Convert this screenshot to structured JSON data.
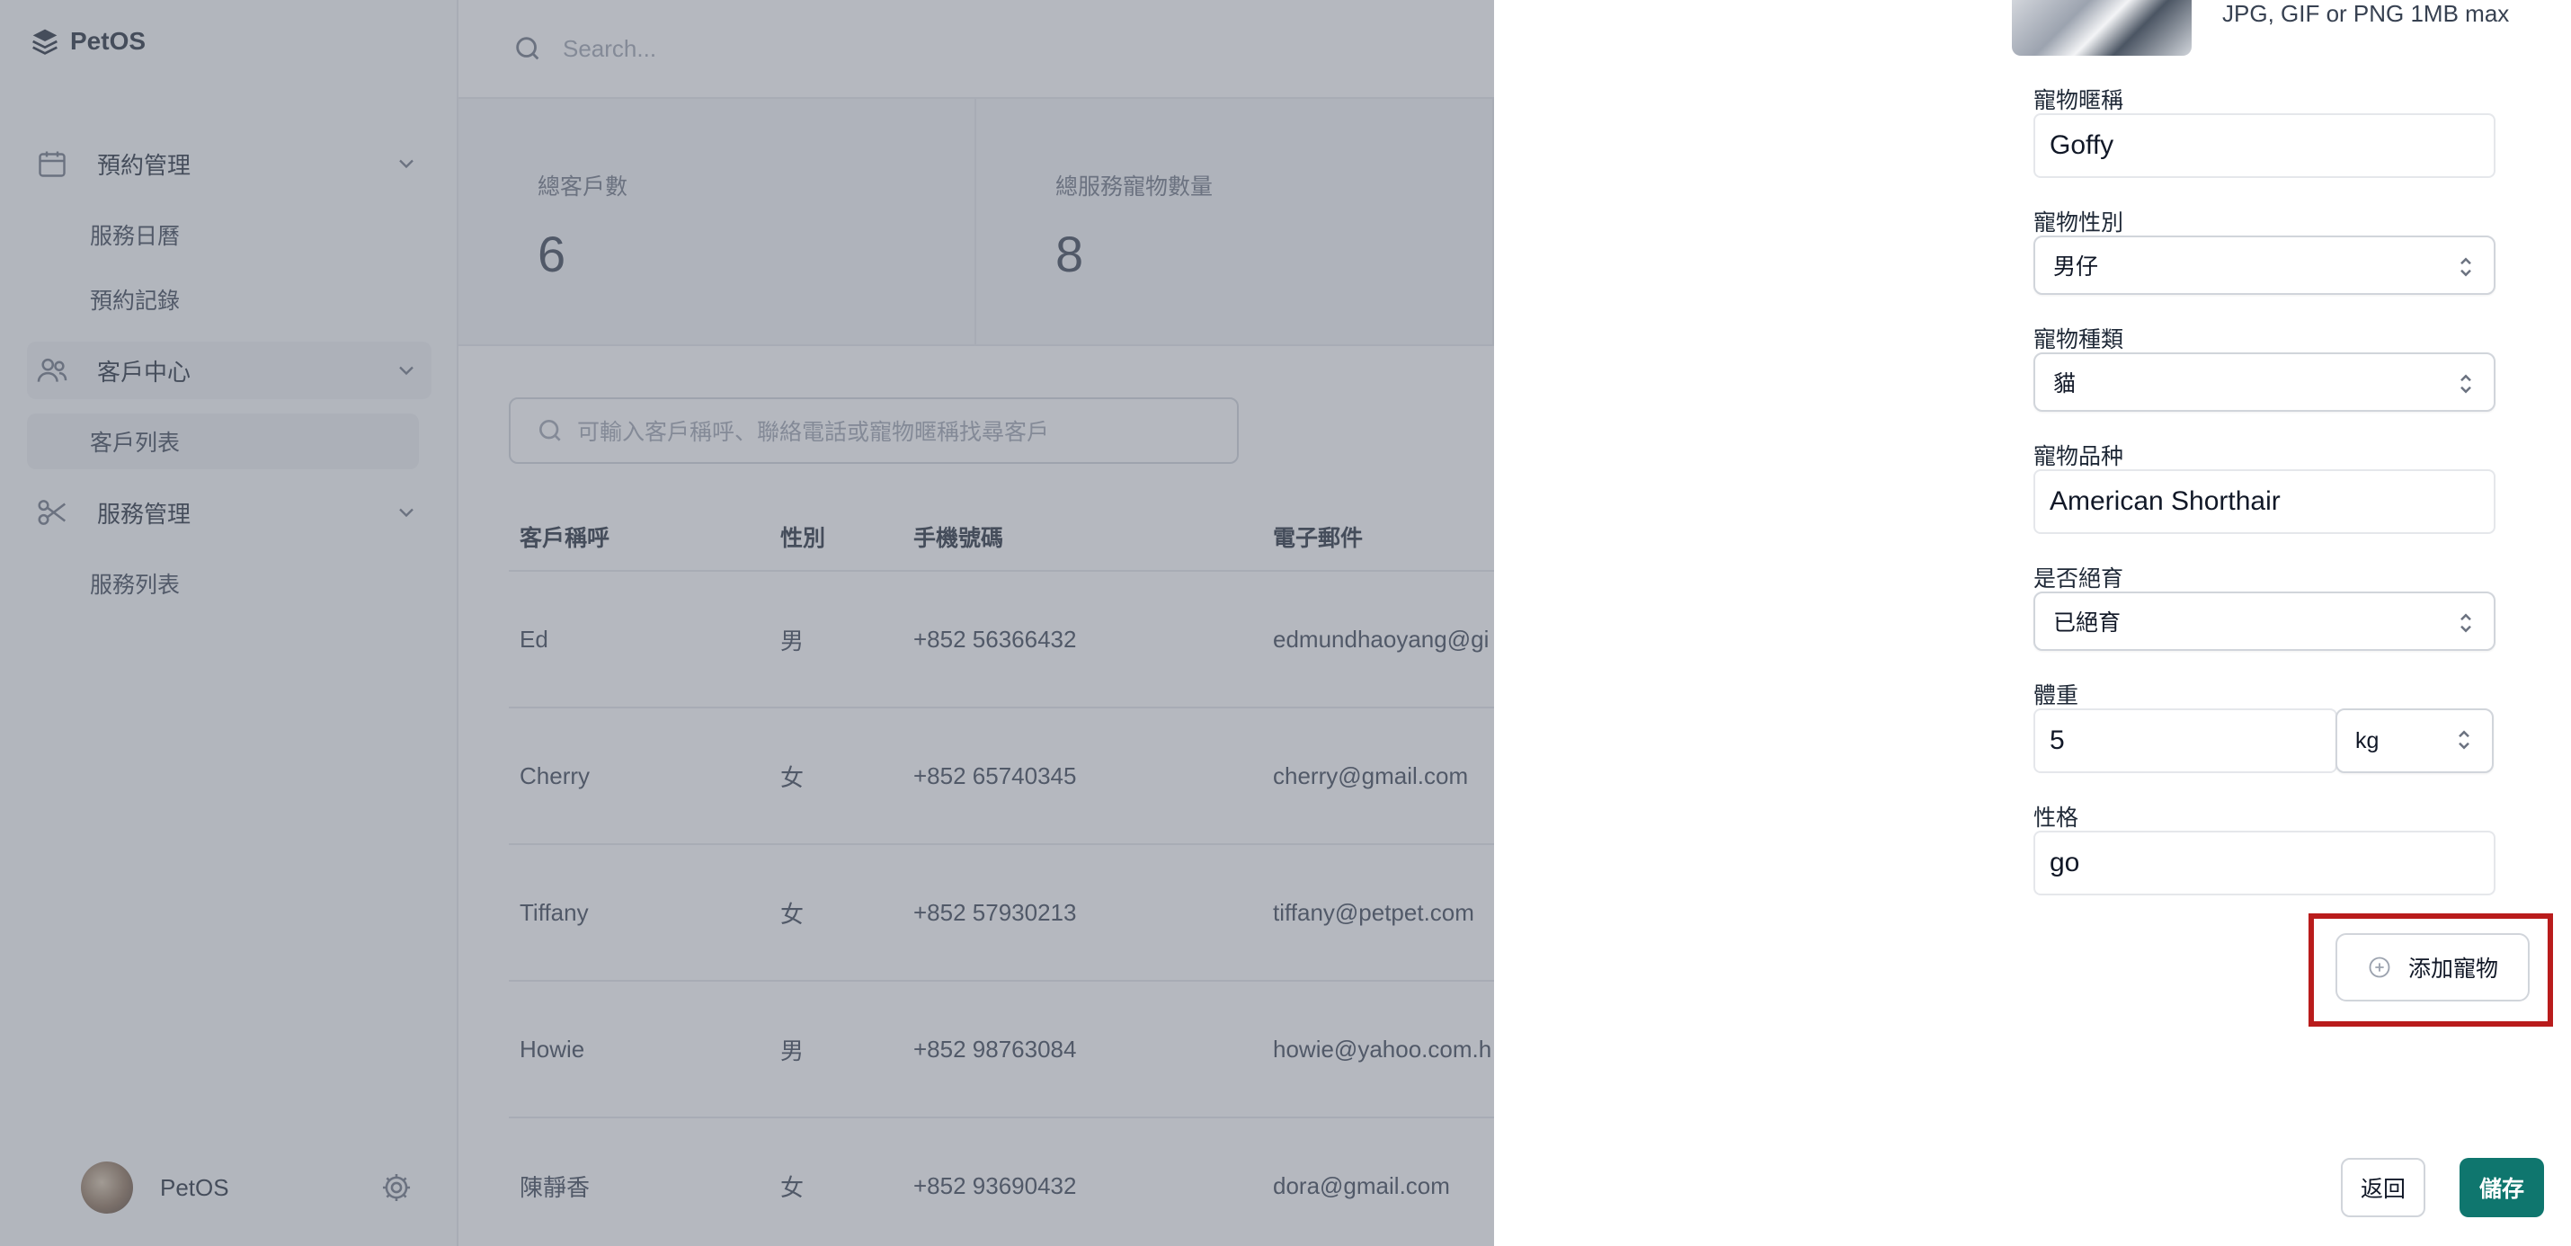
{
  "app": {
    "name": "PetOS"
  },
  "sidebar": {
    "groups": [
      {
        "label": "預約管理",
        "icon": "calendar-icon",
        "items": [
          {
            "label": "服務日曆"
          },
          {
            "label": "預約記錄"
          }
        ]
      },
      {
        "label": "客戶中心",
        "icon": "users-icon",
        "items": [
          {
            "label": "客戶列表"
          }
        ]
      },
      {
        "label": "服務管理",
        "icon": "scissors-icon",
        "items": [
          {
            "label": "服務列表"
          }
        ]
      }
    ],
    "user": {
      "name": "PetOS"
    }
  },
  "topbar": {
    "search_placeholder": "Search..."
  },
  "stats": [
    {
      "label": "總客戶數",
      "value": "6"
    },
    {
      "label": "總服務寵物數量",
      "value": "8"
    }
  ],
  "customers": {
    "search_placeholder": "可輸入客戶稱呼、聯絡電話或寵物暱稱找尋客戶",
    "columns": [
      "客戶稱呼",
      "性別",
      "手機號碼",
      "電子郵件"
    ],
    "rows": [
      [
        "Ed",
        "男",
        "+852 56366432",
        "edmundhaoyang@gi"
      ],
      [
        "Cherry",
        "女",
        "+852 65740345",
        "cherry@gmail.com"
      ],
      [
        "Tiffany",
        "女",
        "+852 57930213",
        "tiffany@petpet.com"
      ],
      [
        "Howie",
        "男",
        "+852 98763084",
        "howie@yahoo.com.h"
      ],
      [
        "陳靜香",
        "女",
        "+852 93690432",
        "dora@gmail.com"
      ]
    ]
  },
  "pet_form": {
    "photo_hint": "JPG, GIF or PNG 1MB max",
    "nickname": {
      "label": "寵物暱稱",
      "value": "Goffy"
    },
    "gender": {
      "label": "寵物性別",
      "value": "男仔"
    },
    "species": {
      "label": "寵物種類",
      "value": "貓"
    },
    "breed": {
      "label": "寵物品种",
      "value": "American Shorthair"
    },
    "neutered": {
      "label": "是否絕育",
      "value": "已絕育"
    },
    "weight": {
      "label": "體重",
      "value": "5",
      "unit": "kg"
    },
    "personality": {
      "label": "性格",
      "value": "go"
    },
    "add_pet_label": "添加寵物",
    "back_label": "返回",
    "save_label": "儲存"
  },
  "colors": {
    "accent": "#0f766e",
    "highlight": "#b91c1c"
  }
}
